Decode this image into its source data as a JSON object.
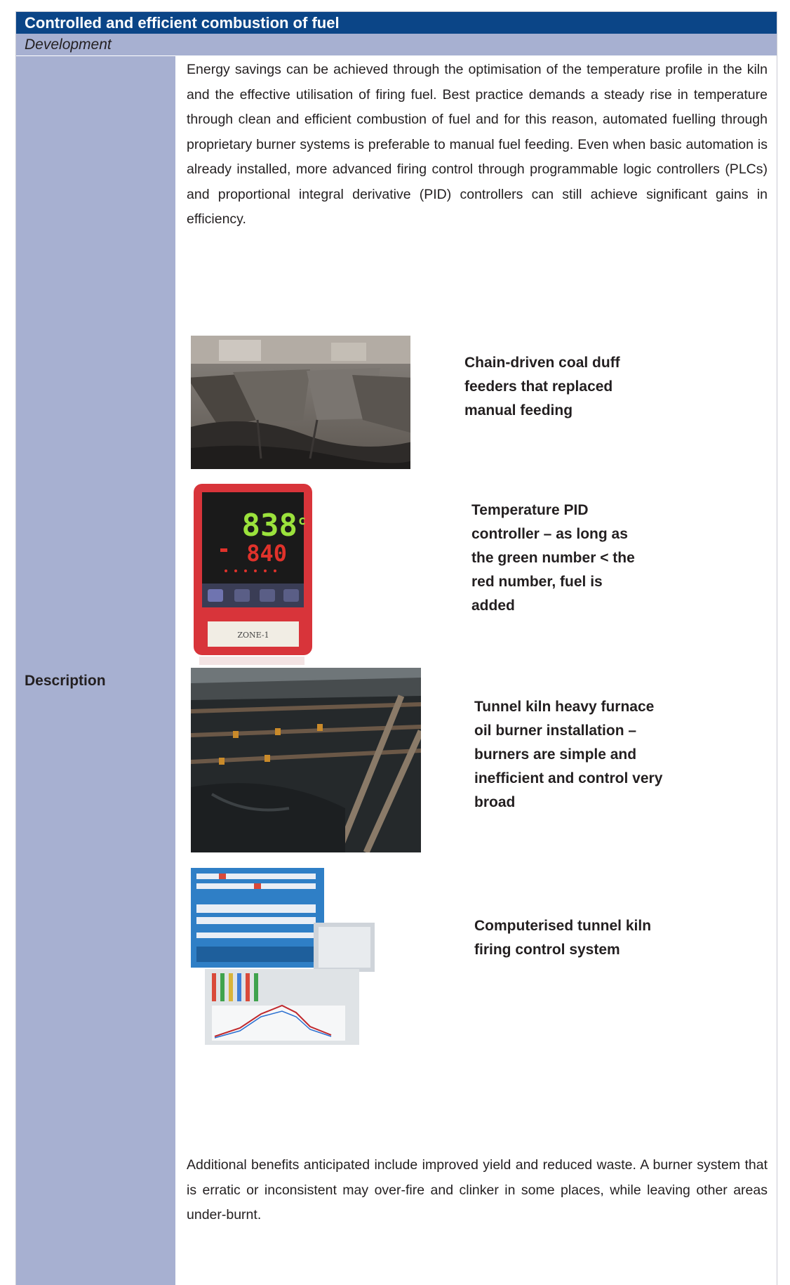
{
  "header": {
    "title": "Controlled and efficient combustion of fuel",
    "subtitle": "Development"
  },
  "row": {
    "label": "Description"
  },
  "content": {
    "intro": "Energy savings can be achieved through the optimisation of the temperature profile in the kiln and the effective utilisation of firing fuel. Best practice demands a steady rise in temperature through clean and efficient combustion of fuel and for this reason, automated fuelling through proprietary burner systems is preferable to manual fuel feeding. Even when basic automation is already installed, more advanced firing control through programmable logic controllers (PLCs) and proportional integral derivative (PID) controllers can still achieve significant gains in efficiency.",
    "figures": [
      {
        "caption": "Chain-driven coal duff feeders that replaced manual feeding"
      },
      {
        "caption": "Temperature PID controller – as long as the green number < the red number, fuel is added",
        "display_pv": "838",
        "display_unit": "c",
        "display_sv": "840",
        "tag": "ZONE-1"
      },
      {
        "caption": "Tunnel kiln heavy furnace oil burner installation – burners are simple and inefficient and control very broad"
      },
      {
        "caption": "Computerised tunnel kiln firing control system"
      }
    ],
    "closing": "Additional benefits anticipated include improved yield and reduced waste. A burner system that is erratic or inconsistent may over-fire and clinker in some places, while leaving other areas under-burnt."
  }
}
